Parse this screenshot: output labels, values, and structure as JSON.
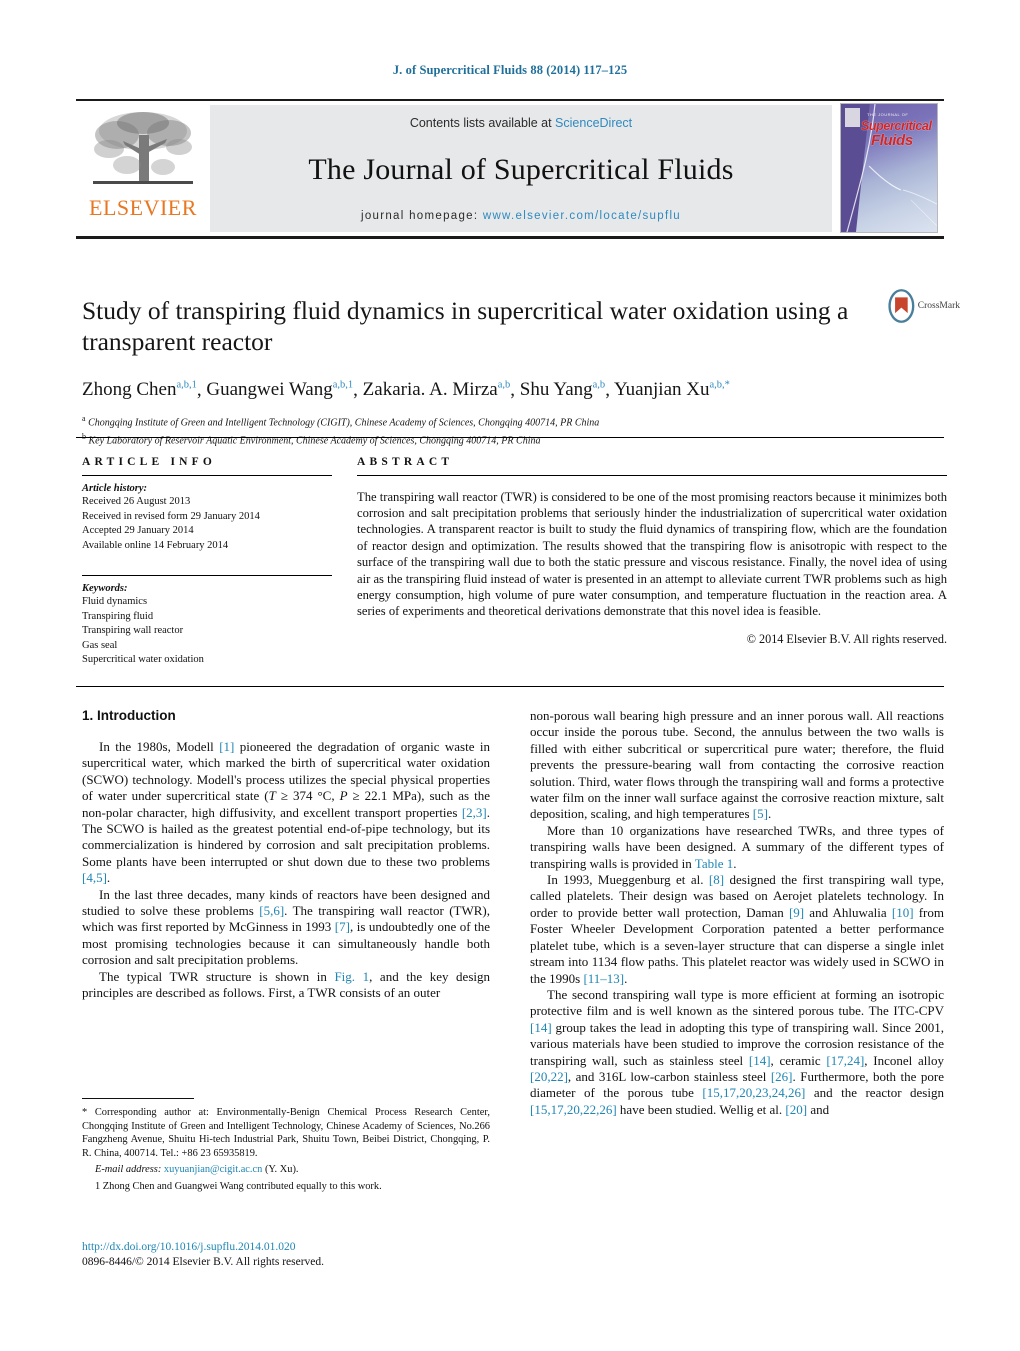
{
  "running_head": "J. of Supercritical Fluids 88 (2014) 117–125",
  "masthead": {
    "publisher_logo_text": "ELSEVIER",
    "contents_prefix": "Contents lists available at ",
    "contents_link": "ScienceDirect",
    "journal_title": "The Journal of Supercritical Fluids",
    "homepage_prefix": "journal homepage: ",
    "homepage_url": "www.elsevier.com/locate/supflu",
    "cover": {
      "eyebrow": "THE JOURNAL OF",
      "line1": "Supercritical",
      "line2": "Fluids"
    }
  },
  "article": {
    "title": "Study of transpiring fluid dynamics in supercritical water oxidation using a transparent reactor",
    "crossmark_label": "CrossMark",
    "authors": [
      {
        "name": "Zhong Chen",
        "sup": "a,b,1"
      },
      {
        "name": "Guangwei Wang",
        "sup": "a,b,1"
      },
      {
        "name": "Zakaria. A. Mirza",
        "sup": "a,b"
      },
      {
        "name": "Shu Yang",
        "sup": "a,b"
      },
      {
        "name": "Yuanjian Xu",
        "sup": "a,b,*"
      }
    ],
    "affiliations": [
      {
        "mark": "a",
        "text": "Chongqing Institute of Green and Intelligent Technology (CIGIT), Chinese Academy of Sciences, Chongqing 400714, PR China"
      },
      {
        "mark": "b",
        "text": "Key Laboratory of Reservoir Aquatic Environment, Chinese Academy of Sciences, Chongqing 400714, PR China"
      }
    ]
  },
  "article_info": {
    "heading": "ARTICLE INFO",
    "history_label": "Article history:",
    "history": [
      "Received 26 August 2013",
      "Received in revised form 29 January 2014",
      "Accepted 29 January 2014",
      "Available online 14 February 2014"
    ],
    "keywords_label": "Keywords:",
    "keywords": [
      "Fluid dynamics",
      "Transpiring fluid",
      "Transpiring wall reactor",
      "Gas seal",
      "Supercritical water oxidation"
    ]
  },
  "abstract": {
    "heading": "ABSTRACT",
    "text": "The transpiring wall reactor (TWR) is considered to be one of the most promising reactors because it minimizes both corrosion and salt precipitation problems that seriously hinder the industrialization of supercritical water oxidation technologies. A transparent reactor is built to study the fluid dynamics of transpiring flow, which are the foundation of reactor design and optimization. The results showed that the transpiring flow is anisotropic with respect to the surface of the transpiring wall due to both the static pressure and viscous resistance. Finally, the novel idea of using air as the transpiring fluid instead of water is presented in an attempt to alleviate current TWR problems such as high energy consumption, high volume of pure water consumption, and temperature fluctuation in the reaction area. A series of experiments and theoretical derivations demonstrate that this novel idea is feasible.",
    "copyright": "© 2014 Elsevier B.V. All rights reserved."
  },
  "body": {
    "section_heading": "1. Introduction",
    "left_paragraphs": [
      "In the 1980s, Modell [1] pioneered the degradation of organic waste in supercritical water, which marked the birth of supercritical water oxidation (SCWO) technology. Modell's process utilizes the special physical properties of water under supercritical state (T ≥ 374 °C, P ≥ 22.1 MPa), such as the non-polar character, high diffusivity, and excellent transport properties [2,3]. The SCWO is hailed as the greatest potential end-of-pipe technology, but its commercialization is hindered by corrosion and salt precipitation problems. Some plants have been interrupted or shut down due to these two problems [4,5].",
      "In the last three decades, many kinds of reactors have been designed and studied to solve these problems [5,6]. The transpiring wall reactor (TWR), which was first reported by McGinness in 1993 [7], is undoubtedly one of the most promising technologies because it can simultaneously handle both corrosion and salt precipitation problems.",
      "The typical TWR structure is shown in Fig. 1, and the key design principles are described as follows. First, a TWR consists of an outer"
    ],
    "right_paragraphs": [
      "non-porous wall bearing high pressure and an inner porous wall. All reactions occur inside the porous tube. Second, the annulus between the two walls is filled with either subcritical or supercritical pure water; therefore, the fluid prevents the pressure-bearing wall from contacting the corrosive reaction solution. Third, water flows through the transpiring wall and forms a protective water film on the inner wall surface against the corrosive reaction mixture, salt deposition, scaling, and high temperatures [5].",
      "More than 10 organizations have researched TWRs, and three types of transpiring walls have been designed. A summary of the different types of transpiring walls is provided in Table 1.",
      "In 1993, Mueggenburg et al. [8] designed the first transpiring wall type, called platelets. Their design was based on Aerojet platelets technology. In order to provide better wall protection, Daman [9] and Ahluwalia [10] from Foster Wheeler Development Corporation patented a better performance platelet tube, which is a seven-layer structure that can disperse a single inlet stream into 1134 flow paths. This platelet reactor was widely used in SCWO in the 1990s [11–13].",
      "The second transpiring wall type is more efficient at forming an isotropic protective film and is well known as the sintered porous tube. The ITC-CPV [14] group takes the lead in adopting this type of transpiring wall. Since 2001, various materials have been studied to improve the corrosion resistance of the transpiring wall, such as stainless steel [14], ceramic [17,24], Inconel alloy [20,22], and 316L low-carbon stainless steel [26]. Furthermore, both the pore diameter of the porous tube [15,17,20,23,24,26] and the reactor design [15,17,20,22,26] have been studied. Wellig et al. [20] and"
    ]
  },
  "footnotes": {
    "corresponding": "* Corresponding author at: Environmentally-Benign Chemical Process Research Center, Chongqing Institute of Green and Intelligent Technology, Chinese Academy of Sciences, No.266 Fangzheng Avenue, Shuitu Hi-tech Industrial Park, Shuitu Town, Beibei District, Chongqing, P. R. China, 400714. Tel.: +86 23 65935819.",
    "email_label": "E-mail address:",
    "email": "xuyuanjian@cigit.ac.cn",
    "email_suffix": "(Y. Xu).",
    "equal_contribution": "1 Zhong Chen and Guangwei Wang contributed equally to this work."
  },
  "imprint": {
    "doi": "http://dx.doi.org/10.1016/j.supflu.2014.01.020",
    "issn_line": "0896-8446/© 2014 Elsevier B.V. All rights reserved."
  },
  "colors": {
    "link": "#1f86b4",
    "elsevier_orange": "#E87722",
    "band_grey": "#e7e8e9"
  }
}
